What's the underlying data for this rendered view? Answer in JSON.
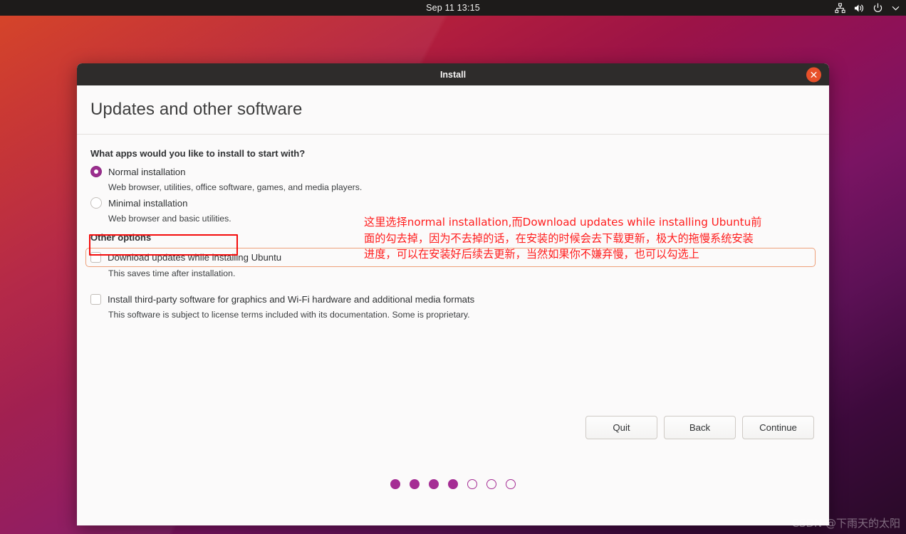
{
  "topbar": {
    "clock": "Sep 11  13:15",
    "icons": [
      "network-icon",
      "volume-icon",
      "power-icon",
      "chevron-down-icon"
    ]
  },
  "window": {
    "title": "Install",
    "close_label": "close-icon",
    "heading": "Updates and other software"
  },
  "content": {
    "apps_question": "What apps would you like to install to start with?",
    "install_options": [
      {
        "label": "Normal installation",
        "description": "Web browser, utilities, office software, games, and media players.",
        "selected": true
      },
      {
        "label": "Minimal installation",
        "description": "Web browser and basic utilities.",
        "selected": false
      }
    ],
    "other_options_label": "Other options",
    "other_options": [
      {
        "label": "Download updates while installing Ubuntu",
        "description": "This saves time after installation.",
        "checked": false,
        "focused": true
      },
      {
        "label": "Install third-party software for graphics and Wi-Fi hardware and additional media formats",
        "description": "This software is subject to license terms included with its documentation. Some is proprietary.",
        "checked": false,
        "focused": false
      }
    ]
  },
  "annotation": {
    "text": "这里选择normal installation,而Download updates while installing Ubuntu前面的勾去掉，因为不去掉的话，在安装的时候会去下载更新，极大的拖慢系统安装进度，可以在安装好后续去更新，当然如果你不嫌弃慢，也可以勾选上",
    "color": "#ff1d1d"
  },
  "buttons": {
    "quit": "Quit",
    "back": "Back",
    "continue": "Continue"
  },
  "progress": {
    "total_steps": 7,
    "completed_steps": 4
  },
  "watermark": {
    "text": "CSDN @下雨天的太阳"
  },
  "colors": {
    "accent_purple": "#9b2e8e",
    "close_orange": "#e8502a",
    "focus_outline": "#eda07a",
    "annotation_red": "#ff1d1d",
    "titlebar": "#2e2c2b"
  }
}
